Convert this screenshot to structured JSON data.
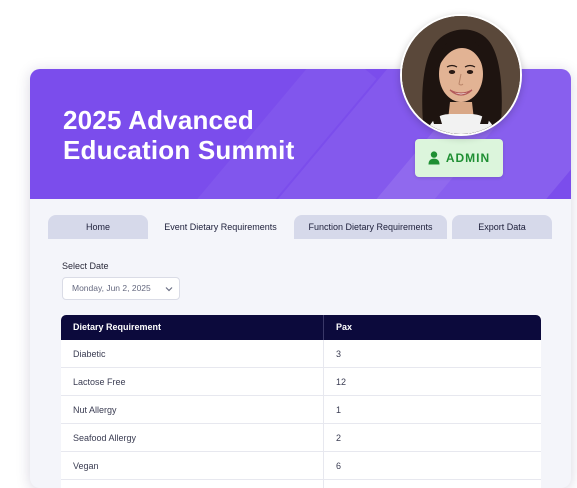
{
  "event": {
    "title_line1": "2025 Advanced",
    "title_line2": "Education Summit"
  },
  "badge": {
    "label": "ADMIN",
    "icon": "user-icon"
  },
  "colors": {
    "header": "#7b4dec",
    "table_header": "#0c0a3c",
    "badge_bg": "#dcf5dc",
    "badge_text": "#1f8f33",
    "tab_bg": "#d6d9ea"
  },
  "tabs": [
    {
      "label": "Home",
      "active": false
    },
    {
      "label": "Event Dietary Requirements",
      "active": true
    },
    {
      "label": "Function Dietary Requirements",
      "active": false
    },
    {
      "label": "Export Data",
      "active": false
    }
  ],
  "date_select": {
    "label": "Select Date",
    "value": "Monday, Jun 2, 2025",
    "icon": "chevron-down-icon"
  },
  "table": {
    "headers": [
      "Dietary Requirement",
      "Pax"
    ],
    "rows": [
      {
        "requirement": "Diabetic",
        "pax": "3"
      },
      {
        "requirement": "Lactose Free",
        "pax": "12"
      },
      {
        "requirement": "Nut Allergy",
        "pax": "1"
      },
      {
        "requirement": "Seafood Allergy",
        "pax": "2"
      },
      {
        "requirement": "Vegan",
        "pax": "6"
      }
    ]
  }
}
